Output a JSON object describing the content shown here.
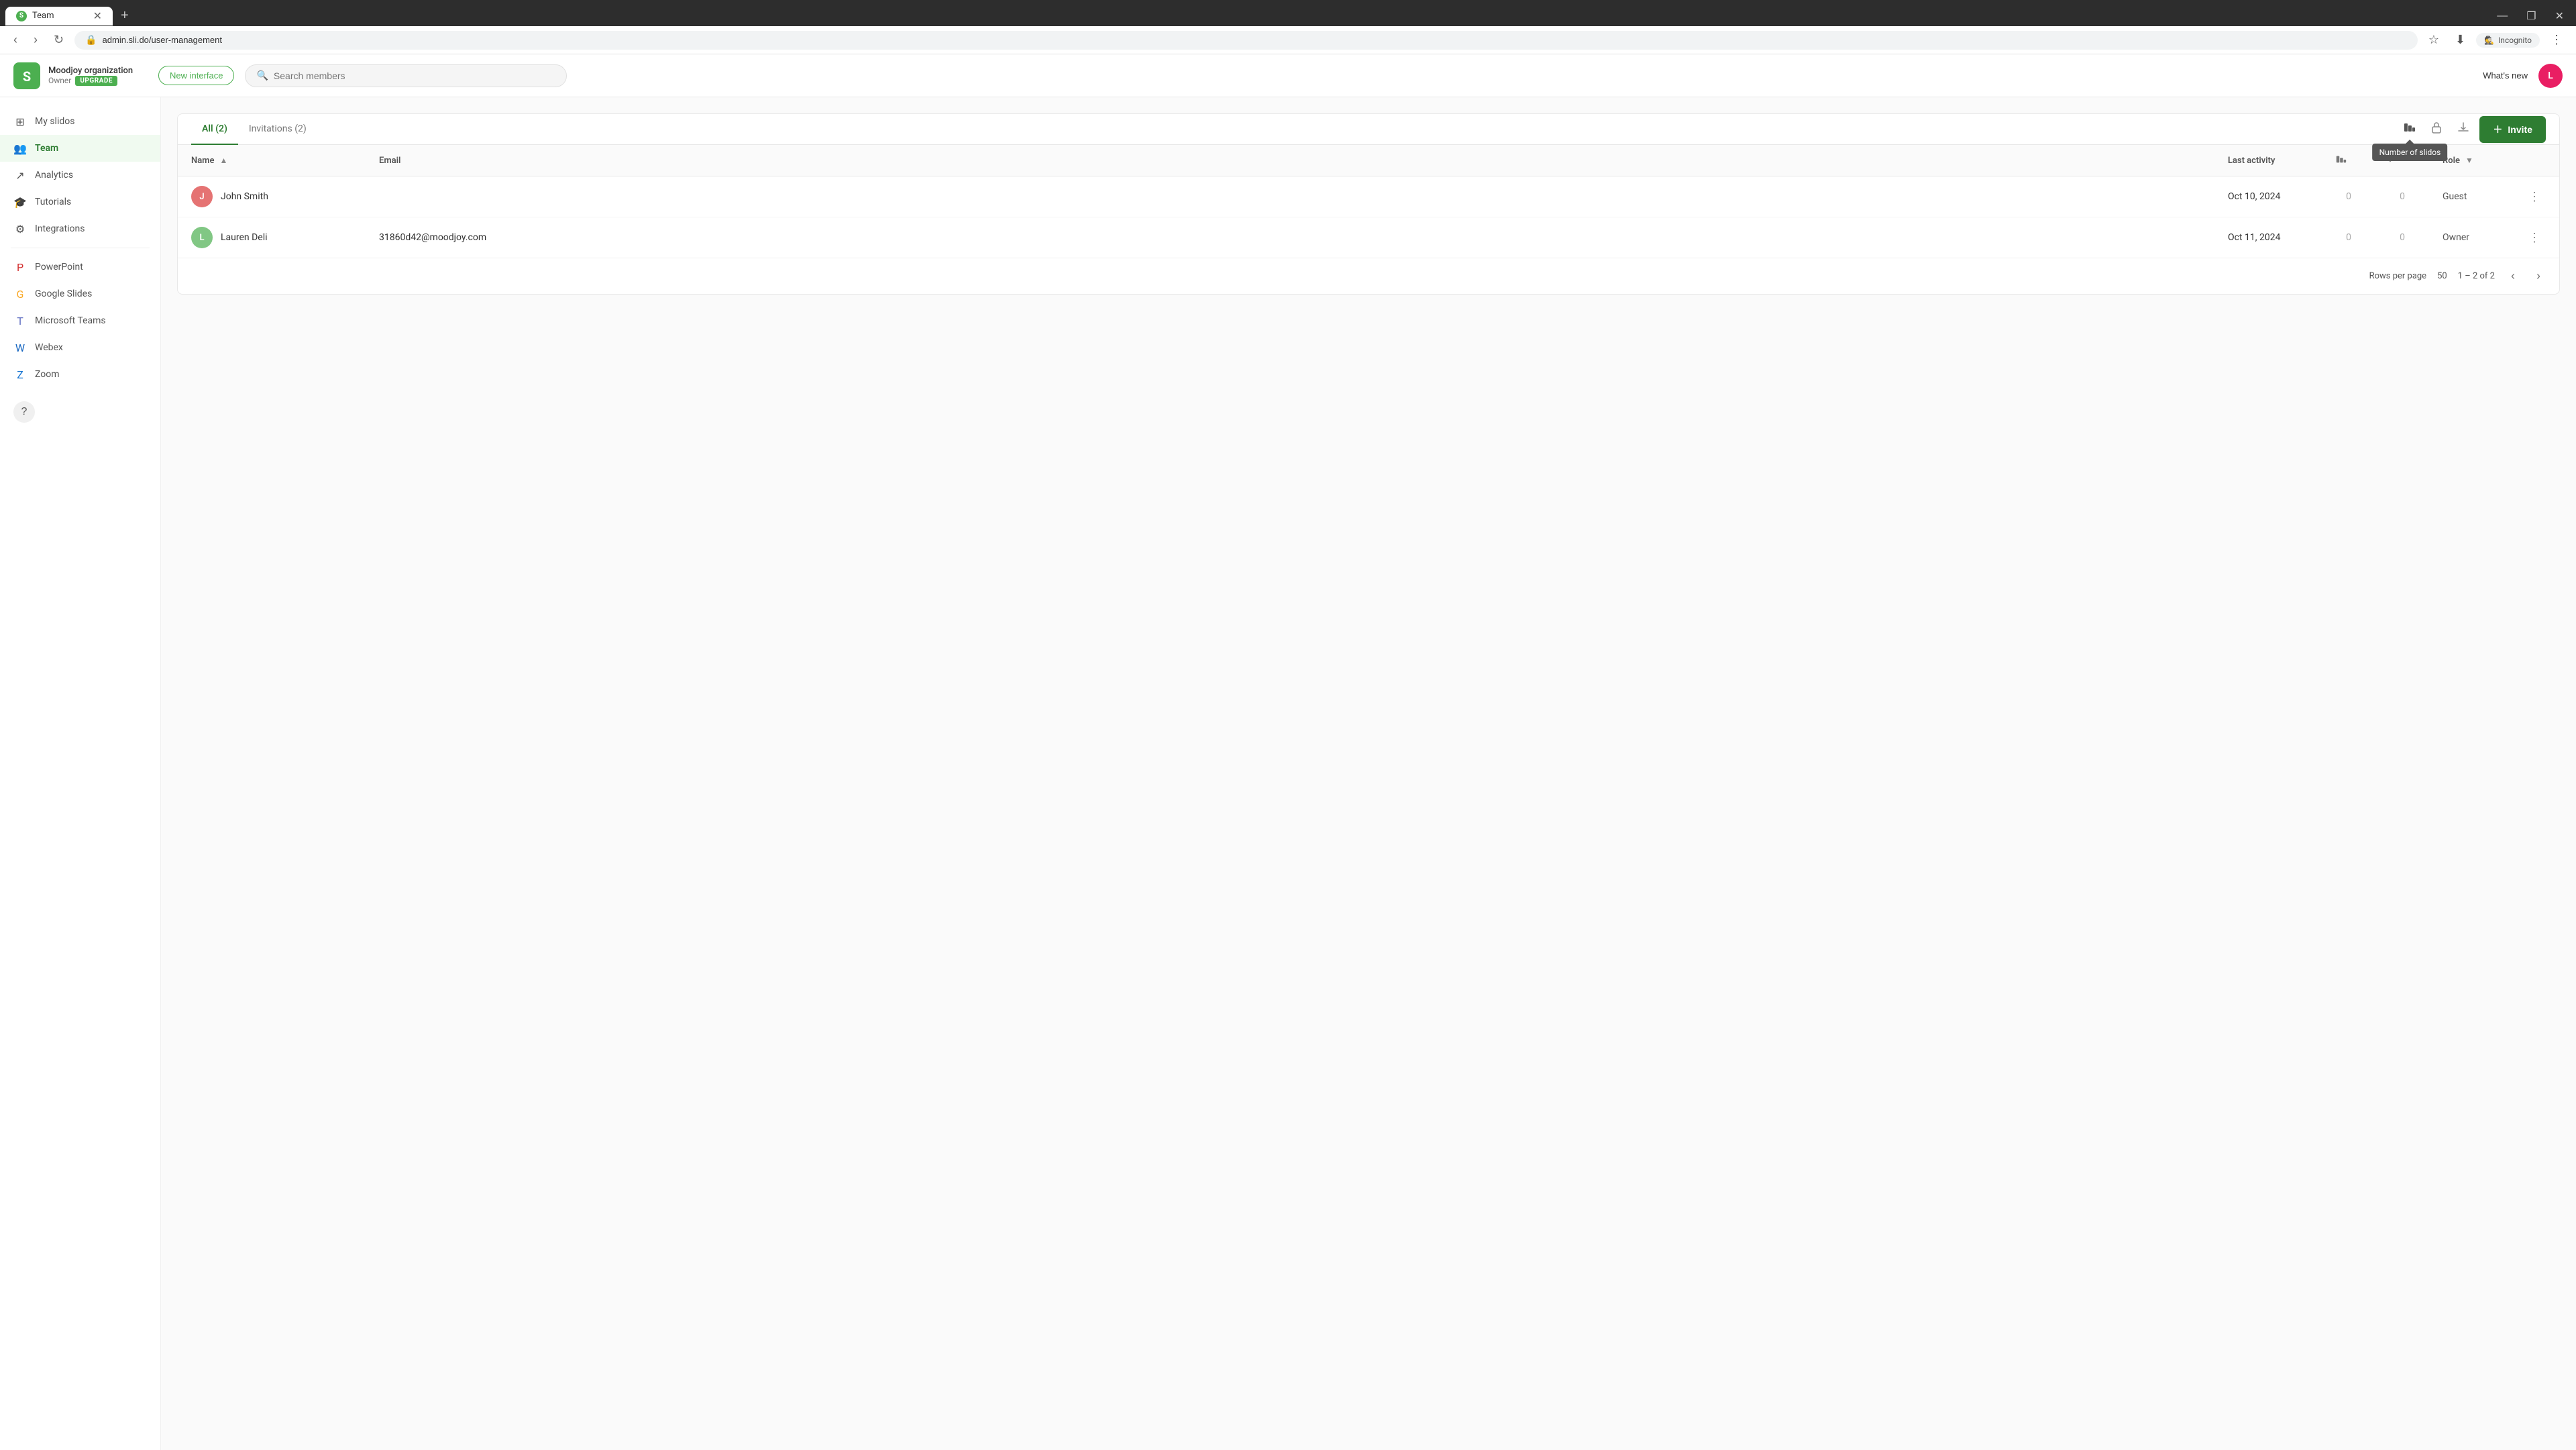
{
  "browser": {
    "tab_label": "Team",
    "tab_favicon": "S",
    "url": "admin.sli.do/user-management",
    "incognito_label": "Incognito"
  },
  "header": {
    "org_name": "Moodjoy organization",
    "org_role": "Owner",
    "upgrade_label": "UPGRADE",
    "new_interface_label": "New interface",
    "search_placeholder": "Search members",
    "whats_new_label": "What's new",
    "avatar_initials": "L"
  },
  "sidebar": {
    "items": [
      {
        "id": "my-slidos",
        "label": "My slidos",
        "icon": "⊞",
        "active": false
      },
      {
        "id": "team",
        "label": "Team",
        "icon": "👥",
        "active": true
      },
      {
        "id": "analytics",
        "label": "Analytics",
        "icon": "↗",
        "active": false
      },
      {
        "id": "tutorials",
        "label": "Tutorials",
        "icon": "🎓",
        "active": false
      },
      {
        "id": "integrations",
        "label": "Integrations",
        "icon": "⚙",
        "active": false
      }
    ],
    "integrations": [
      {
        "id": "powerpoint",
        "label": "PowerPoint",
        "icon": "P",
        "color": "#d32f2f"
      },
      {
        "id": "google-slides",
        "label": "Google Slides",
        "icon": "G",
        "color": "#f9a825"
      },
      {
        "id": "microsoft-teams",
        "label": "Microsoft Teams",
        "icon": "T",
        "color": "#5c6bc0"
      },
      {
        "id": "webex",
        "label": "Webex",
        "icon": "W",
        "color": "#1565c0"
      },
      {
        "id": "zoom",
        "label": "Zoom",
        "icon": "Z",
        "color": "#1976d2"
      }
    ]
  },
  "team_page": {
    "tabs": [
      {
        "id": "all",
        "label": "All (2)",
        "active": true
      },
      {
        "id": "invitations",
        "label": "Invitations (2)",
        "active": false
      }
    ],
    "tooltip_number_of_slidos": "Number of slidos",
    "invite_button_label": "Invite",
    "table": {
      "columns": [
        {
          "id": "name",
          "label": "Name",
          "sortable": true
        },
        {
          "id": "email",
          "label": "Email",
          "sortable": false
        },
        {
          "id": "last_activity",
          "label": "Last activity",
          "sortable": false
        },
        {
          "id": "slidos",
          "label": "",
          "icon": "slidos-icon"
        },
        {
          "id": "trend",
          "label": "",
          "icon": "trend-icon"
        },
        {
          "id": "role",
          "label": "Role",
          "sortable": false,
          "filterable": true
        }
      ],
      "rows": [
        {
          "id": "row-1",
          "avatar_letter": "J",
          "avatar_class": "j",
          "name": "John Smith",
          "email": "",
          "last_activity": "Oct 10, 2024",
          "slidos": "0",
          "trend": "0",
          "role": "Guest"
        },
        {
          "id": "row-2",
          "avatar_letter": "L",
          "avatar_class": "l",
          "name": "Lauren Deli",
          "email": "31860d42@moodjoy.com",
          "last_activity": "Oct 11, 2024",
          "slidos": "0",
          "trend": "0",
          "role": "Owner"
        }
      ]
    },
    "pagination": {
      "rows_per_page_label": "Rows per page",
      "rows_per_page_value": "50",
      "range_label": "1 – 2 of 2"
    }
  }
}
